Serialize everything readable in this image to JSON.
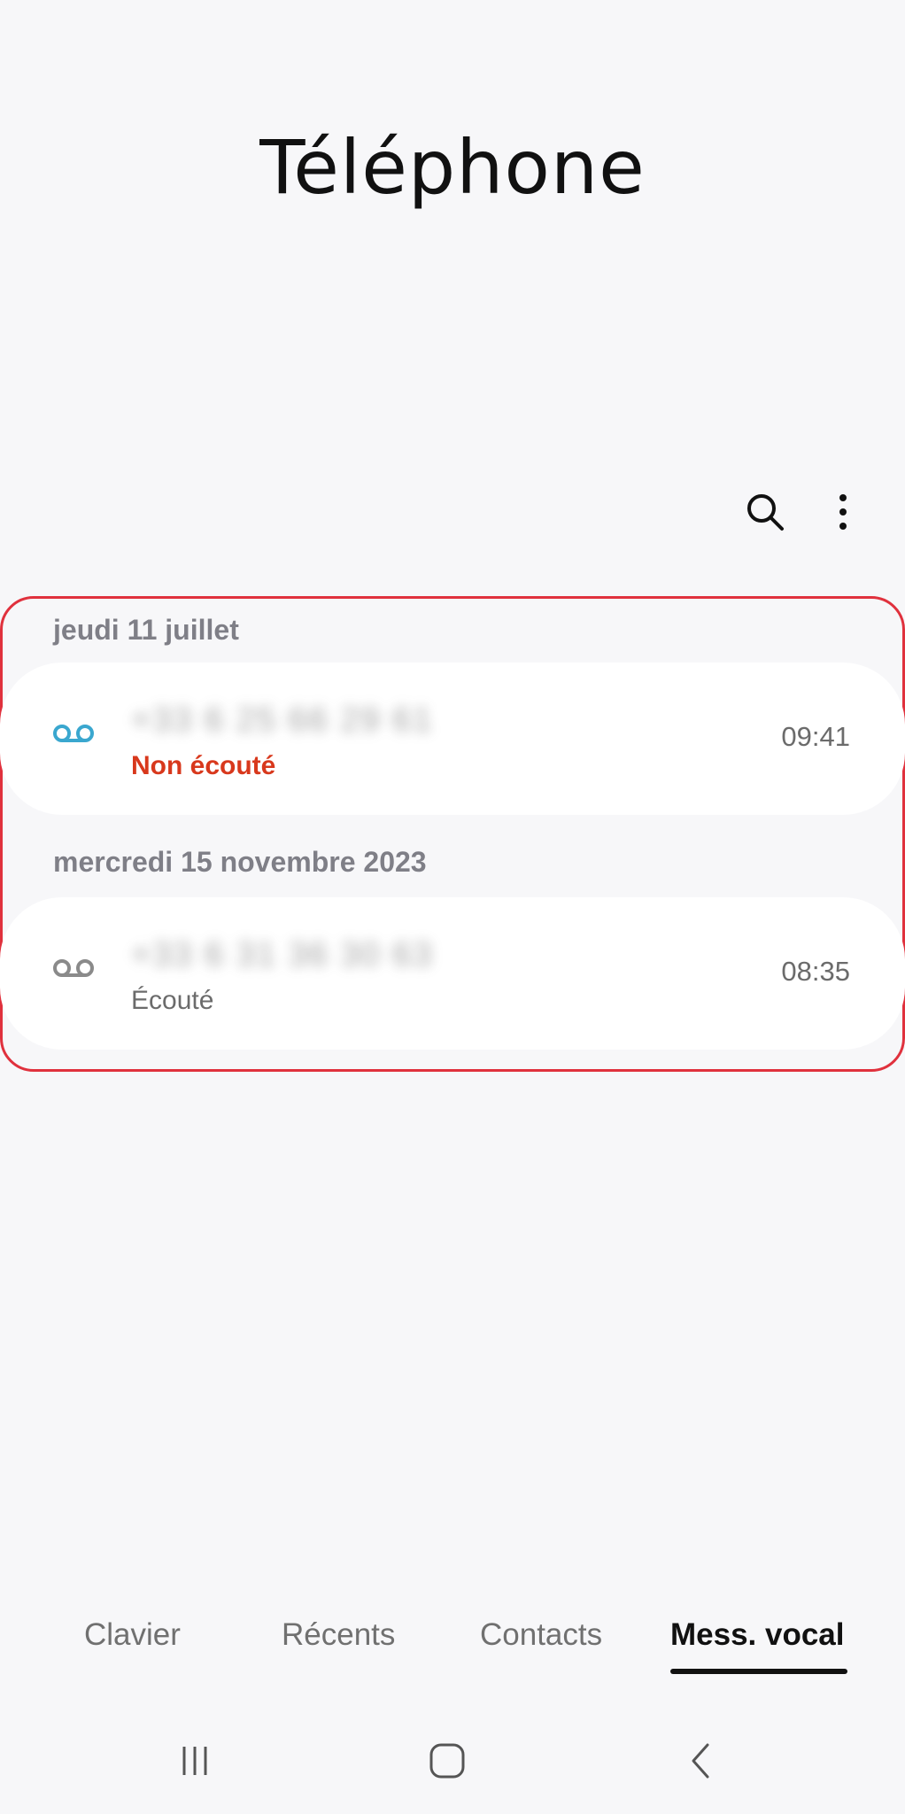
{
  "app": {
    "title": "Téléphone"
  },
  "toolbar": {
    "search_icon": "search-icon",
    "more_icon": "more-vert-icon"
  },
  "voicemail_groups": [
    {
      "date": "jeudi 11 juillet",
      "items": [
        {
          "number": "+33 6 25 66 29 61",
          "status": "Non écouté",
          "time": "09:41",
          "icon_color": "#3aa7cf"
        }
      ]
    },
    {
      "date": "mercredi 15 novembre 2023",
      "items": [
        {
          "number": "+33 6 31 36 30 63",
          "status": "Écouté",
          "time": "08:35",
          "icon_color": "#8a8a8a"
        }
      ]
    }
  ],
  "tabs": [
    {
      "label": "Clavier"
    },
    {
      "label": "Récents"
    },
    {
      "label": "Contacts"
    },
    {
      "label": "Mess. vocal",
      "selected": true
    }
  ],
  "nav": {
    "recents_icon": "recent-apps-icon",
    "home_icon": "home-icon",
    "back_icon": "back-icon"
  },
  "colors": {
    "unread_status": "#d8381c",
    "highlight_border": "#e0313d",
    "background": "#f7f7f9"
  }
}
